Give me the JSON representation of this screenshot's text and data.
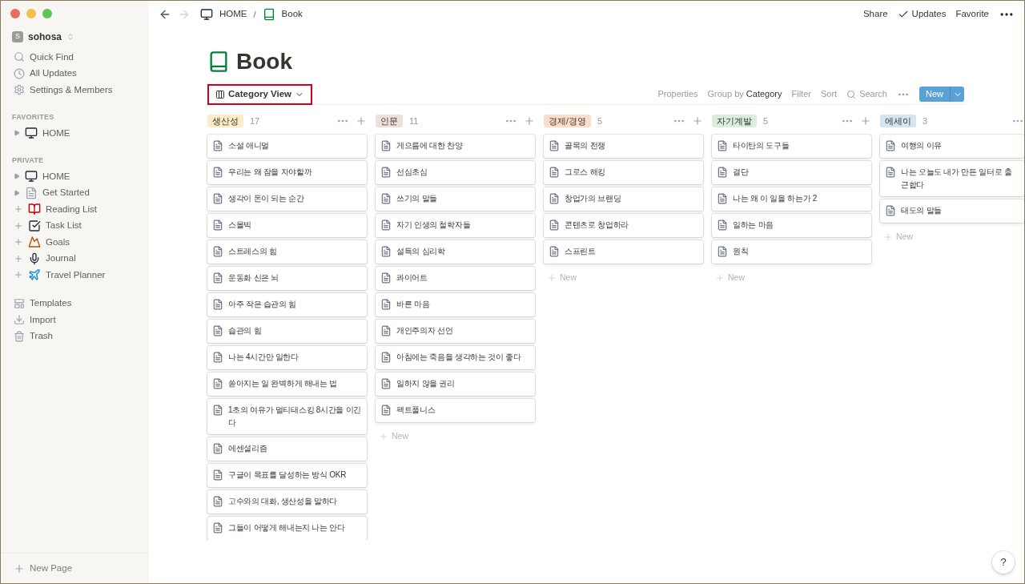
{
  "workspace": {
    "initial": "S",
    "name": "sohosa"
  },
  "sidebar_top": [
    "Quick Find",
    "All Updates",
    "Settings & Members"
  ],
  "favorites": {
    "heading": "FAVORITES",
    "items": [
      {
        "label": "HOME",
        "kind": "toggle"
      }
    ]
  },
  "private": {
    "heading": "PRIVATE",
    "items": [
      {
        "label": "HOME",
        "kind": "toggle"
      },
      {
        "label": "Get Started",
        "kind": "toggle"
      },
      {
        "label": "Reading List",
        "kind": "add"
      },
      {
        "label": "Task List",
        "kind": "add"
      },
      {
        "label": "Goals",
        "kind": "add"
      },
      {
        "label": "Journal",
        "kind": "add"
      },
      {
        "label": "Travel Planner",
        "kind": "add"
      }
    ]
  },
  "sidebar_bottom": [
    "Templates",
    "Import",
    "Trash"
  ],
  "new_page": "New Page",
  "breadcrumbs": [
    "HOME",
    "Book"
  ],
  "breadcrumb_separator": "/",
  "top_actions": [
    "Share",
    "Updates",
    "Favorite"
  ],
  "title": "Book",
  "view": {
    "label": "Category View"
  },
  "toolbar": {
    "properties": "Properties",
    "group_by": "Group by",
    "group_value": "Category",
    "filter": "Filter",
    "sort": "Sort",
    "search": "Search",
    "new": "New"
  },
  "columns": [
    {
      "tag": "생산성",
      "color": "#fdecc8",
      "count": "17",
      "cards": [
        "소설 애니멀",
        "우리는 왜 잠을 자야할까",
        "생각이 돈이 되는 순간",
        "스몰빅",
        "스트레스의 힘",
        "운동화 신은 뇌",
        "아주 작은 습관의 힘",
        "습관의 힘",
        "나는 4시간만 일한다",
        "쏟아지는 일 완벽하게 해내는 법",
        "1초의 여유가 멀티태스킹 8시간을 이긴다",
        "에센셜리즘",
        "구글이 목표를 달성하는 방식 OKR",
        "고수와의 대화, 생산성을 말하다",
        "그들이 어떻게 해내는지 나는 안다"
      ]
    },
    {
      "tag": "인문",
      "color": "#eee0da",
      "count": "11",
      "cards": [
        "게으름에 대한 찬양",
        "선심초심",
        "쓰기의 말들",
        "자기 인생의 철학자들",
        "설득의 심리학",
        "콰이어트",
        "바른 마음",
        "개인주의자 선언",
        "아침에는 죽음을 생각하는 것이 좋다",
        "일하지 않을 권리",
        "팩트풀니스"
      ],
      "new": "New"
    },
    {
      "tag": "경제/경영",
      "color": "#fadec9",
      "count": "5",
      "cards": [
        "골목의 전쟁",
        "그로스 해킹",
        "창업가의 브랜딩",
        "콘텐츠로 창업하라",
        "스프린트"
      ],
      "new": "New"
    },
    {
      "tag": "자기계발",
      "color": "#dbeddb",
      "count": "5",
      "cards": [
        "타이탄의 도구들",
        "결단",
        "나는 왜 이 일을 하는가 2",
        "일하는 마음",
        "원칙"
      ],
      "new": "New"
    },
    {
      "tag": "에세이",
      "color": "#d3e5ef",
      "count": "3",
      "cards": [
        "여행의 이유",
        "나는 오늘도 내가 만든 일터로 출근합다",
        "태도의 말들"
      ],
      "new": "New"
    }
  ],
  "help": "?"
}
